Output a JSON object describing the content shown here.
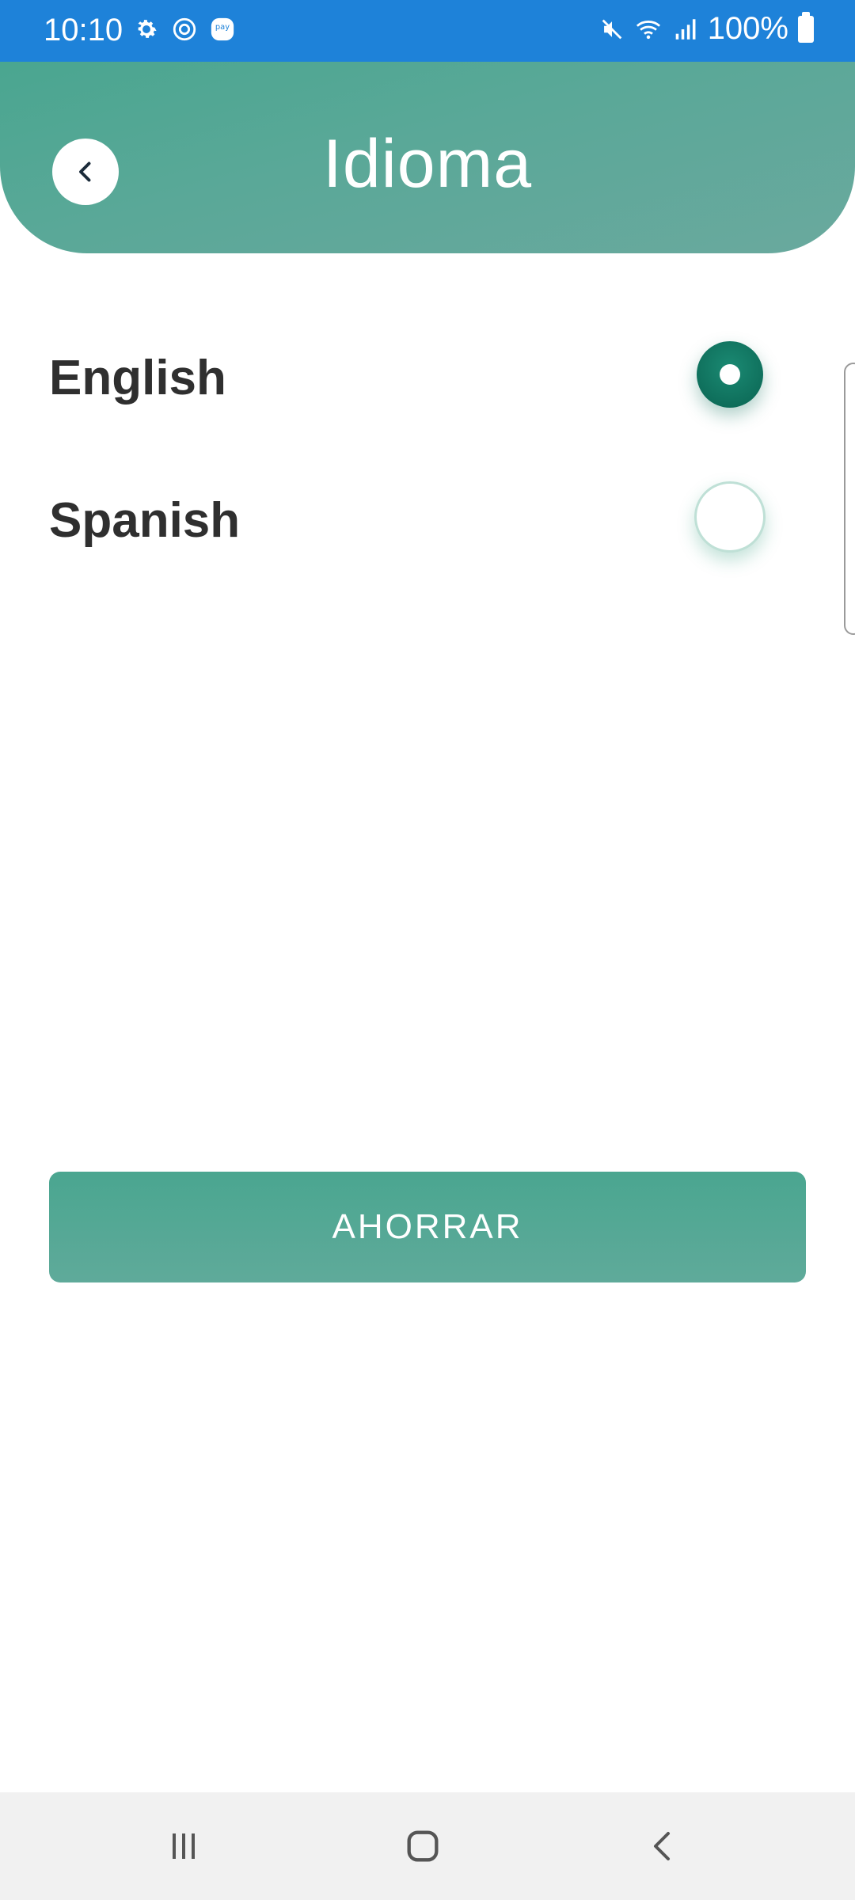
{
  "status_bar": {
    "time": "10:10",
    "battery": "100%",
    "icons": [
      "settings-icon",
      "screen-record-icon",
      "pay-icon",
      "mute-icon",
      "wifi-icon",
      "signal-icon",
      "battery-icon"
    ]
  },
  "header": {
    "title": "Idioma",
    "back_icon": "chevron-left-icon"
  },
  "options": [
    {
      "label": "English",
      "selected": true
    },
    {
      "label": "Spanish",
      "selected": false
    }
  ],
  "save_button": {
    "label": "AHORRAR"
  },
  "nav_bar": {
    "icons": [
      "recent-apps-icon",
      "home-icon",
      "back-icon"
    ]
  },
  "colors": {
    "status_bar": "#1e82d9",
    "header": "#4aa690",
    "radio_selected": "#0d6b58",
    "button": "#4aa690",
    "text": "#2f2f2f"
  }
}
